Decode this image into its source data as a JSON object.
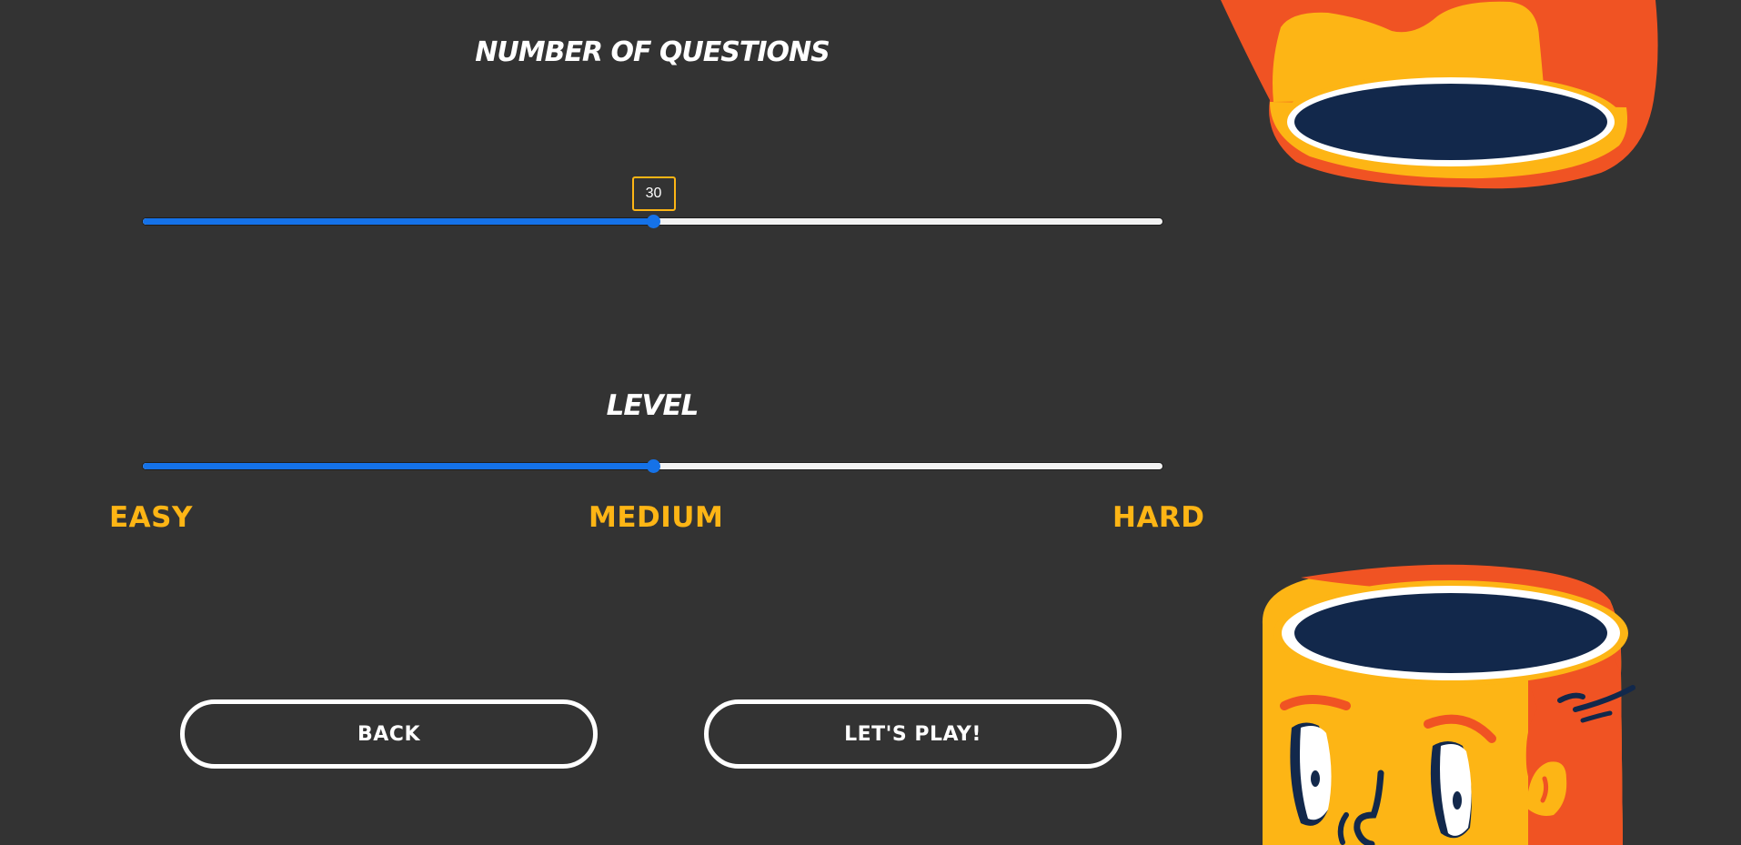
{
  "questions": {
    "heading": "NUMBER OF QUESTIONS",
    "value": "30",
    "slider_fraction": 0.5
  },
  "level": {
    "heading": "LEVEL",
    "slider_fraction": 0.5,
    "labels": {
      "easy": "EASY",
      "medium": "MEDIUM",
      "hard": "HARD"
    }
  },
  "buttons": {
    "back": "BACK",
    "play": "LET'S PLAY!"
  },
  "colors": {
    "background": "#333333",
    "accent_yellow": "#fdb515",
    "slider_blue": "#1572e8",
    "mascot_orange": "#f05323",
    "mascot_navy": "#12284b"
  }
}
